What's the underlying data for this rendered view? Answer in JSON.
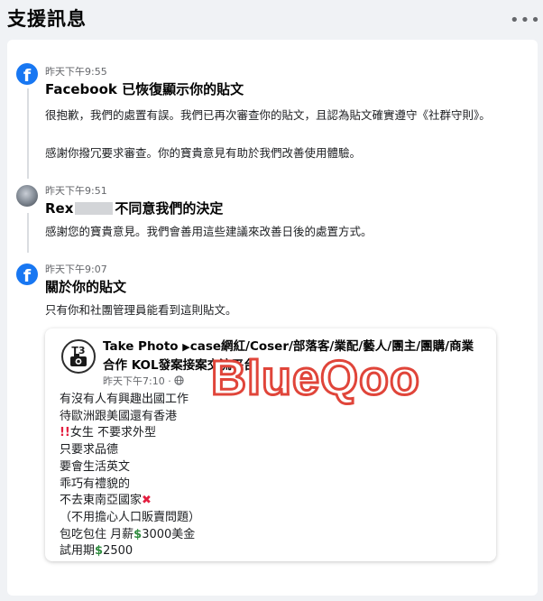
{
  "page": {
    "title": "支援訊息",
    "more_icon": "more-dots-icon"
  },
  "entries": [
    {
      "icon": "facebook-icon",
      "time": "昨天下午9:55",
      "title": "Facebook 已恢復顯示你的貼文",
      "paragraphs": [
        "很抱歉，我們的處置有誤。我們已再次審查你的貼文，且認為貼文確實遵守《社群守則》。",
        "感謝你撥冗要求審查。你的寶貴意見有助於我們改善使用體驗。"
      ]
    },
    {
      "icon": "user-avatar",
      "time": "昨天下午9:51",
      "title_name": "Rex",
      "title_rest": "不同意我們的決定",
      "paragraphs": [
        "感謝您的寶貴意見。我們會善用這些建議來改善日後的處置方式。"
      ]
    },
    {
      "icon": "facebook-icon",
      "time": "昨天下午9:07",
      "title": "關於你的貼文",
      "paragraphs": [
        "只有你和社團管理員能看到這則貼文。"
      ]
    }
  ],
  "post": {
    "author": "Take Photo",
    "group": "case網紅/Coser/部落客/業配/藝人/團主/團購/商業合作 KOL發案接案交流平台",
    "time": "昨天下午7:10",
    "lines": [
      "有沒有人有興趣出國工作",
      "待歐洲跟美國還有香港",
      "女生 不要求外型",
      "只要求品德",
      "要會生活英文",
      "乖巧有禮貌的",
      "不去東南亞國家",
      "（不用擔心人口販賣問題）",
      "包吃包住 月薪",
      "3000美金",
      "試用期",
      "2500"
    ]
  },
  "watermark": "BlueQoo",
  "colors": {
    "facebook_blue": "#1877f2",
    "watermark_red": "#e0453a",
    "background": "#f0f2f5"
  }
}
